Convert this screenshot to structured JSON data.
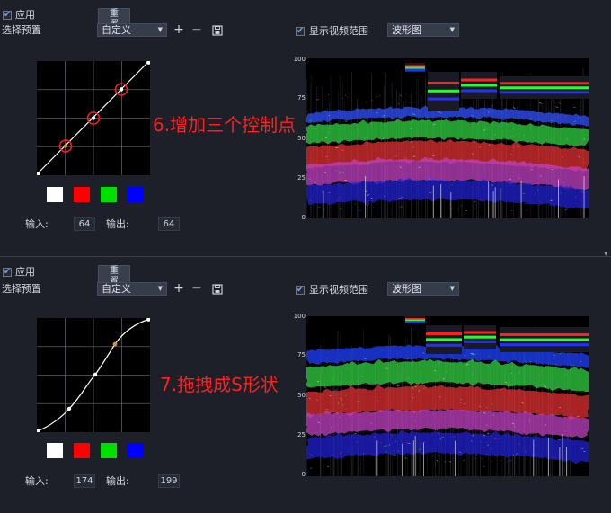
{
  "panels": [
    {
      "apply_label": "应用",
      "reset_label": "重置",
      "preset_label": "选择预置",
      "preset_value": "自定义",
      "add_icon": "+",
      "remove_icon": "−",
      "show_range_label": "显示视频范围",
      "scope_mode": "波形图",
      "input_label": "输入:",
      "input_value": "64",
      "output_label": "输出:",
      "output_value": "64",
      "annotation": "6.增加三个控制点",
      "scale_ticks": [
        "100",
        "75",
        "50",
        "25",
        "0"
      ],
      "swatch_colors": [
        "#ffffff",
        "#ff0000",
        "#00e000",
        "#0000ff"
      ],
      "curve": "linear"
    },
    {
      "apply_label": "应用",
      "reset_label": "重置",
      "preset_label": "选择预置",
      "preset_value": "自定义",
      "add_icon": "+",
      "remove_icon": "−",
      "show_range_label": "显示视频范围",
      "scope_mode": "波形图",
      "input_label": "输入:",
      "input_value": "174",
      "output_label": "输出:",
      "output_value": "199",
      "annotation": "7.拖拽成S形状",
      "scale_ticks": [
        "100",
        "75",
        "50",
        "25",
        "0"
      ],
      "swatch_colors": [
        "#ffffff",
        "#ff0000",
        "#00e000",
        "#0000ff"
      ],
      "curve": "s-curve"
    }
  ]
}
